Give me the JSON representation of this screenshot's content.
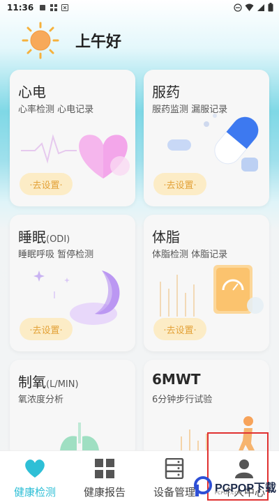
{
  "status_bar": {
    "time": "11:36"
  },
  "header": {
    "greeting": "上午好"
  },
  "cards": [
    {
      "title": "心电",
      "unit": "",
      "subtitle": "心率检测 心电记录",
      "button": "·去设置·"
    },
    {
      "title": "服药",
      "unit": "",
      "subtitle": "服药监测 漏服记录",
      "button": "·去设置·"
    },
    {
      "title": "睡眠",
      "unit": "(ODI)",
      "subtitle": "睡眠呼吸 暂停检测",
      "button": "·去设置·"
    },
    {
      "title": "体脂",
      "unit": "",
      "subtitle": "体脂检测 体脂记录",
      "button": "·去设置·"
    },
    {
      "title": "制氧",
      "unit": "(L/MIN)",
      "subtitle": "氧浓度分析",
      "button": ""
    },
    {
      "title": "6MWT",
      "unit": "",
      "subtitle": "6分钟步行试验",
      "button": ""
    }
  ],
  "tabs": [
    {
      "label": "健康检测",
      "icon": "heart-icon",
      "active": true
    },
    {
      "label": "健康报告",
      "icon": "grid-icon",
      "active": false
    },
    {
      "label": "设备管理",
      "icon": "server-icon",
      "active": false
    },
    {
      "label": "个人中心",
      "icon": "user-icon",
      "active": false
    }
  ],
  "watermark": {
    "text": "PCPOP下载",
    "sub": "PCPOP.COM"
  },
  "colors": {
    "accent": "#2ebfd6",
    "button_bg": "#fcecc6",
    "button_text": "#e3a238",
    "highlight": "#e03030"
  }
}
